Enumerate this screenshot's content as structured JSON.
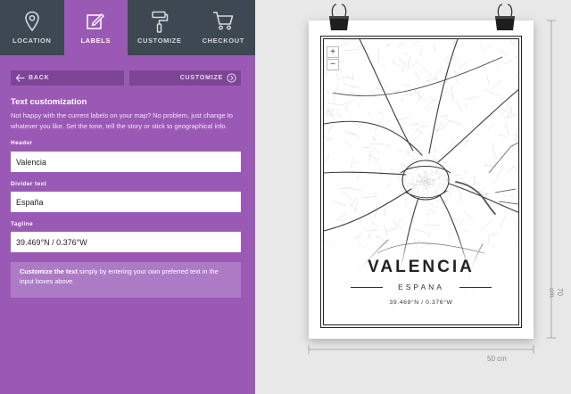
{
  "tabs": [
    {
      "label": "LOCATION",
      "icon": "map-pin-icon",
      "active": false
    },
    {
      "label": "LABELS",
      "icon": "pencil-edit-icon",
      "active": true
    },
    {
      "label": "CUSTOMIZE",
      "icon": "paint-roller-icon",
      "active": false
    },
    {
      "label": "CHECKOUT",
      "icon": "shopping-cart-icon",
      "active": false
    }
  ],
  "nav": {
    "back_label": "BACK",
    "customize_label": "CUSTOMIZE"
  },
  "section": {
    "title": "Text customization",
    "description": "Not happy with the current labels on your map? No problem, just change to whatever you like. Set the tone, tell the story or stick to geographical info."
  },
  "fields": {
    "header": {
      "label": "Header",
      "value": "Valencia"
    },
    "divider": {
      "label": "Divider text",
      "value": "España"
    },
    "tagline": {
      "label": "Tagline",
      "value": "39.469°N / 0.376°W"
    }
  },
  "info": {
    "bold": "Customize the text",
    "rest": " simply by entering your own preferred text in the input boxes above."
  },
  "poster": {
    "city": "VALENCIA",
    "divider": "ESPANA",
    "tagline": "39.469°N / 0.376°W",
    "zoom_in": "+",
    "zoom_out": "−",
    "width_label": "50 cm",
    "height_label": "70 cm"
  },
  "colors": {
    "panel": "#9b59b6",
    "tabbar": "#3d4852",
    "button": "#7d4595",
    "infobox": "#ad7bc6"
  }
}
